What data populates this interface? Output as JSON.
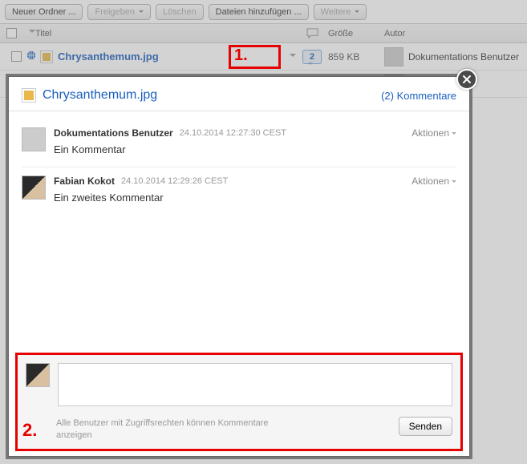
{
  "toolbar": {
    "new_folder": "Neuer Ordner ...",
    "share": "Freigeben",
    "delete": "Löschen",
    "add_files": "Dateien hinzufügen ...",
    "more": "Weitere"
  },
  "list_header": {
    "title": "Titel",
    "size": "Größe",
    "author": "Autor"
  },
  "rows": [
    {
      "filename": "Chrysanthemum.jpg",
      "comment_count": "2",
      "size": "859 KB",
      "author": "Dokumentations Benutzer"
    },
    {
      "author_tail": "s Benutzer"
    }
  ],
  "annotation": {
    "one": "1.",
    "two": "2."
  },
  "popup": {
    "filename": "Chrysanthemum.jpg",
    "comments_link": "(2) Kommentare",
    "actions_label": "Aktionen",
    "comments": [
      {
        "author": "Dokumentations Benutzer",
        "date": "24.10.2014 12:27:30 CEST",
        "text": "Ein Kommentar"
      },
      {
        "author": "Fabian Kokot",
        "date": "24.10.2014 12:29:26 CEST",
        "text": "Ein zweites Kommentar"
      }
    ],
    "compose": {
      "hint": "Alle Benutzer mit Zugriffsrechten können Kommentare anzeigen",
      "send": "Senden"
    }
  }
}
